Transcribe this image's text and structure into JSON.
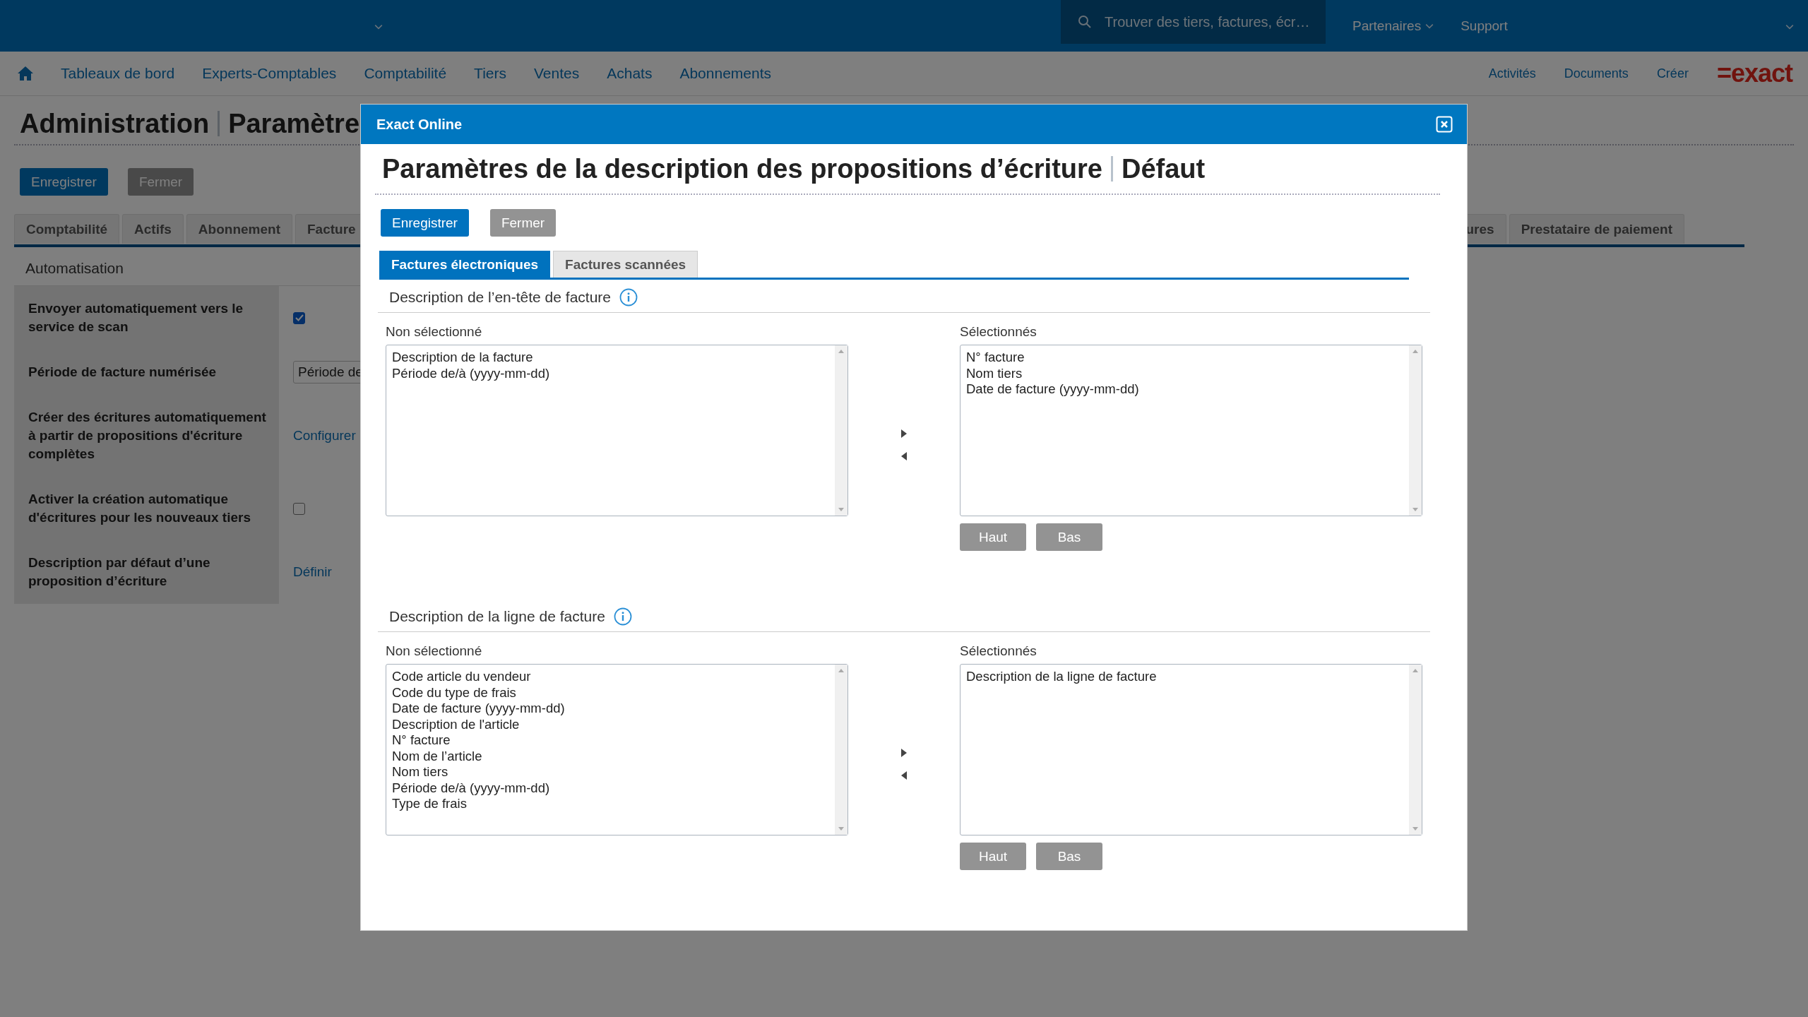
{
  "top_bar": {
    "search": {
      "placeholder": "Trouver des tiers, factures, écr…"
    },
    "links": [
      {
        "label": "Partenaires",
        "kind": "dropdown"
      },
      {
        "label": "Support",
        "kind": "link"
      }
    ]
  },
  "nav": {
    "items": [
      "Tableaux de bord",
      "Experts-Comptables",
      "Comptabilité",
      "Tiers",
      "Ventes",
      "Achats",
      "Abonnements"
    ],
    "right_items": [
      "Activités",
      "Documents",
      "Créer"
    ],
    "logo": "=exact"
  },
  "page": {
    "title": "Administration",
    "subtitle": "Paramètre",
    "buttons": [
      {
        "label": "Enregistrer",
        "kind": "primary"
      },
      {
        "label": "Fermer",
        "kind": "secondary"
      }
    ],
    "tabs_left": [
      {
        "label": "Comptabilité",
        "selected": false
      },
      {
        "label": "Actifs",
        "selected": false
      },
      {
        "label": "Abonnement",
        "selected": false
      },
      {
        "label": "Facture",
        "selected": false
      }
    ],
    "tabs_right": [
      {
        "label": "ures",
        "selected": false
      },
      {
        "label": "Prestataire de paiement",
        "selected": false
      }
    ],
    "section": "Automatisation",
    "settings": [
      {
        "label": "Envoyer automatiquement vers le service de scan",
        "kind": "checkbox",
        "checked": true
      },
      {
        "label": "Période de facture numérisée",
        "kind": "select",
        "value": "Période de"
      },
      {
        "label": "Créer des écritures automatiquement à partir de propositions d'écriture complètes",
        "kind": "link",
        "link": "Configurer"
      },
      {
        "label": "Activer la création automatique d'écritures pour les nouveaux tiers",
        "kind": "checkbox",
        "checked": false
      },
      {
        "label": "Description par défaut d’une proposition d’écriture",
        "kind": "link",
        "link": "Définir"
      }
    ]
  },
  "dialog": {
    "title": "Exact Online",
    "heading": "Paramètres de la description des propositions d’écriture",
    "subheading": "Défaut",
    "buttons": [
      {
        "label": "Enregistrer",
        "kind": "primary"
      },
      {
        "label": "Fermer",
        "kind": "secondary"
      }
    ],
    "tabs": [
      {
        "label": "Factures électroniques",
        "selected": true
      },
      {
        "label": "Factures scannées",
        "selected": false
      }
    ],
    "sections": [
      {
        "title": "Description de l’en-tête de facture",
        "available_label": "Non sélectionné",
        "available": [
          "Description de la facture",
          "Période de/à (yyyy-mm-dd)"
        ],
        "selected_label": "Sélectionnés",
        "selected": [
          "N° facture",
          "Nom tiers",
          "Date de facture (yyyy-mm-dd)"
        ],
        "buttons": [
          "Haut",
          "Bas"
        ]
      },
      {
        "title": "Description de la ligne de facture",
        "available_label": "Non sélectionné",
        "available": [
          "Code article du vendeur",
          "Code du type de frais",
          "Date de facture (yyyy-mm-dd)",
          "Description de l'article",
          "N° facture",
          "Nom de l’article",
          "Nom tiers",
          "Période de/à (yyyy-mm-dd)",
          "Type de frais"
        ],
        "selected_label": "Sélectionnés",
        "selected": [
          "Description de la ligne de facture"
        ],
        "buttons": [
          "Haut",
          "Bas"
        ]
      }
    ]
  }
}
